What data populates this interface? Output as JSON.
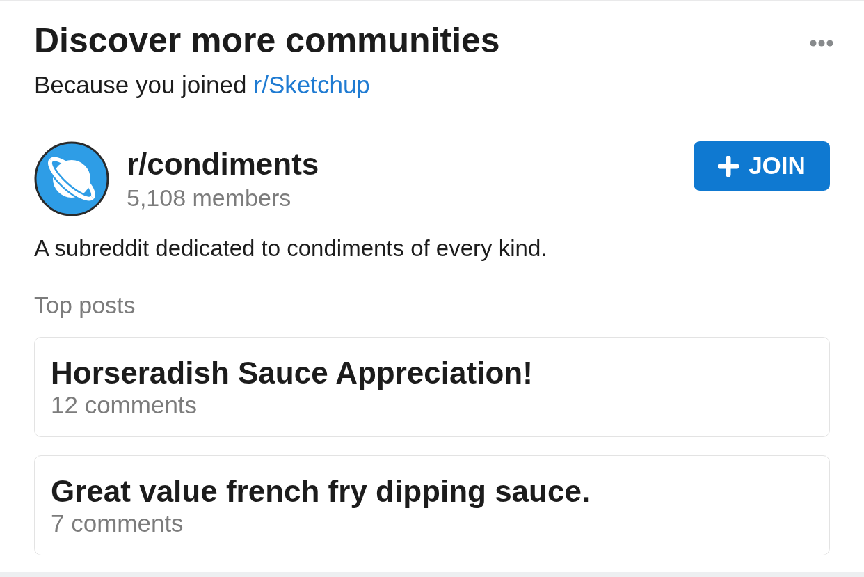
{
  "header": {
    "title": "Discover more communities",
    "reason_text": "Because you joined",
    "reason_link": "r/Sketchup"
  },
  "community": {
    "name": "r/condiments",
    "members": "5,108 members",
    "join_label": "JOIN",
    "description": "A subreddit dedicated to condiments of every kind."
  },
  "top_posts": {
    "heading": "Top posts",
    "posts": [
      {
        "title": "Horseradish Sauce Appreciation!",
        "comments": "12 comments"
      },
      {
        "title": "Great value french fry dipping sauce.",
        "comments": "7 comments"
      }
    ]
  }
}
